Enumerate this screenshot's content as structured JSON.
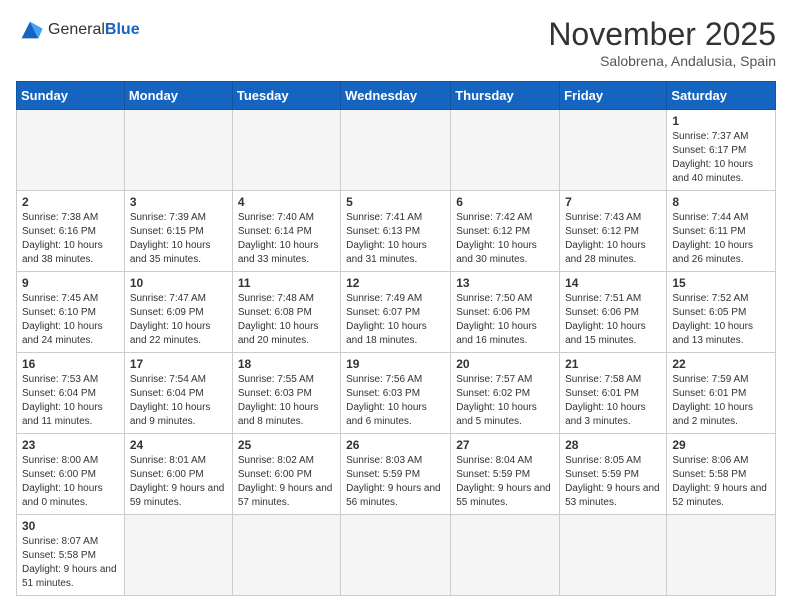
{
  "header": {
    "logo_general": "General",
    "logo_blue": "Blue",
    "month_title": "November 2025",
    "location": "Salobrena, Andalusia, Spain"
  },
  "weekdays": [
    "Sunday",
    "Monday",
    "Tuesday",
    "Wednesday",
    "Thursday",
    "Friday",
    "Saturday"
  ],
  "weeks": [
    [
      {
        "day": "",
        "info": ""
      },
      {
        "day": "",
        "info": ""
      },
      {
        "day": "",
        "info": ""
      },
      {
        "day": "",
        "info": ""
      },
      {
        "day": "",
        "info": ""
      },
      {
        "day": "",
        "info": ""
      },
      {
        "day": "1",
        "info": "Sunrise: 7:37 AM\nSunset: 6:17 PM\nDaylight: 10 hours\nand 40 minutes."
      }
    ],
    [
      {
        "day": "2",
        "info": "Sunrise: 7:38 AM\nSunset: 6:16 PM\nDaylight: 10 hours\nand 38 minutes."
      },
      {
        "day": "3",
        "info": "Sunrise: 7:39 AM\nSunset: 6:15 PM\nDaylight: 10 hours\nand 35 minutes."
      },
      {
        "day": "4",
        "info": "Sunrise: 7:40 AM\nSunset: 6:14 PM\nDaylight: 10 hours\nand 33 minutes."
      },
      {
        "day": "5",
        "info": "Sunrise: 7:41 AM\nSunset: 6:13 PM\nDaylight: 10 hours\nand 31 minutes."
      },
      {
        "day": "6",
        "info": "Sunrise: 7:42 AM\nSunset: 6:12 PM\nDaylight: 10 hours\nand 30 minutes."
      },
      {
        "day": "7",
        "info": "Sunrise: 7:43 AM\nSunset: 6:12 PM\nDaylight: 10 hours\nand 28 minutes."
      },
      {
        "day": "8",
        "info": "Sunrise: 7:44 AM\nSunset: 6:11 PM\nDaylight: 10 hours\nand 26 minutes."
      }
    ],
    [
      {
        "day": "9",
        "info": "Sunrise: 7:45 AM\nSunset: 6:10 PM\nDaylight: 10 hours\nand 24 minutes."
      },
      {
        "day": "10",
        "info": "Sunrise: 7:47 AM\nSunset: 6:09 PM\nDaylight: 10 hours\nand 22 minutes."
      },
      {
        "day": "11",
        "info": "Sunrise: 7:48 AM\nSunset: 6:08 PM\nDaylight: 10 hours\nand 20 minutes."
      },
      {
        "day": "12",
        "info": "Sunrise: 7:49 AM\nSunset: 6:07 PM\nDaylight: 10 hours\nand 18 minutes."
      },
      {
        "day": "13",
        "info": "Sunrise: 7:50 AM\nSunset: 6:06 PM\nDaylight: 10 hours\nand 16 minutes."
      },
      {
        "day": "14",
        "info": "Sunrise: 7:51 AM\nSunset: 6:06 PM\nDaylight: 10 hours\nand 15 minutes."
      },
      {
        "day": "15",
        "info": "Sunrise: 7:52 AM\nSunset: 6:05 PM\nDaylight: 10 hours\nand 13 minutes."
      }
    ],
    [
      {
        "day": "16",
        "info": "Sunrise: 7:53 AM\nSunset: 6:04 PM\nDaylight: 10 hours\nand 11 minutes."
      },
      {
        "day": "17",
        "info": "Sunrise: 7:54 AM\nSunset: 6:04 PM\nDaylight: 10 hours\nand 9 minutes."
      },
      {
        "day": "18",
        "info": "Sunrise: 7:55 AM\nSunset: 6:03 PM\nDaylight: 10 hours\nand 8 minutes."
      },
      {
        "day": "19",
        "info": "Sunrise: 7:56 AM\nSunset: 6:03 PM\nDaylight: 10 hours\nand 6 minutes."
      },
      {
        "day": "20",
        "info": "Sunrise: 7:57 AM\nSunset: 6:02 PM\nDaylight: 10 hours\nand 5 minutes."
      },
      {
        "day": "21",
        "info": "Sunrise: 7:58 AM\nSunset: 6:01 PM\nDaylight: 10 hours\nand 3 minutes."
      },
      {
        "day": "22",
        "info": "Sunrise: 7:59 AM\nSunset: 6:01 PM\nDaylight: 10 hours\nand 2 minutes."
      }
    ],
    [
      {
        "day": "23",
        "info": "Sunrise: 8:00 AM\nSunset: 6:00 PM\nDaylight: 10 hours\nand 0 minutes."
      },
      {
        "day": "24",
        "info": "Sunrise: 8:01 AM\nSunset: 6:00 PM\nDaylight: 9 hours\nand 59 minutes."
      },
      {
        "day": "25",
        "info": "Sunrise: 8:02 AM\nSunset: 6:00 PM\nDaylight: 9 hours\nand 57 minutes."
      },
      {
        "day": "26",
        "info": "Sunrise: 8:03 AM\nSunset: 5:59 PM\nDaylight: 9 hours\nand 56 minutes."
      },
      {
        "day": "27",
        "info": "Sunrise: 8:04 AM\nSunset: 5:59 PM\nDaylight: 9 hours\nand 55 minutes."
      },
      {
        "day": "28",
        "info": "Sunrise: 8:05 AM\nSunset: 5:59 PM\nDaylight: 9 hours\nand 53 minutes."
      },
      {
        "day": "29",
        "info": "Sunrise: 8:06 AM\nSunset: 5:58 PM\nDaylight: 9 hours\nand 52 minutes."
      }
    ],
    [
      {
        "day": "30",
        "info": "Sunrise: 8:07 AM\nSunset: 5:58 PM\nDaylight: 9 hours\nand 51 minutes."
      },
      {
        "day": "",
        "info": ""
      },
      {
        "day": "",
        "info": ""
      },
      {
        "day": "",
        "info": ""
      },
      {
        "day": "",
        "info": ""
      },
      {
        "day": "",
        "info": ""
      },
      {
        "day": "",
        "info": ""
      }
    ]
  ]
}
